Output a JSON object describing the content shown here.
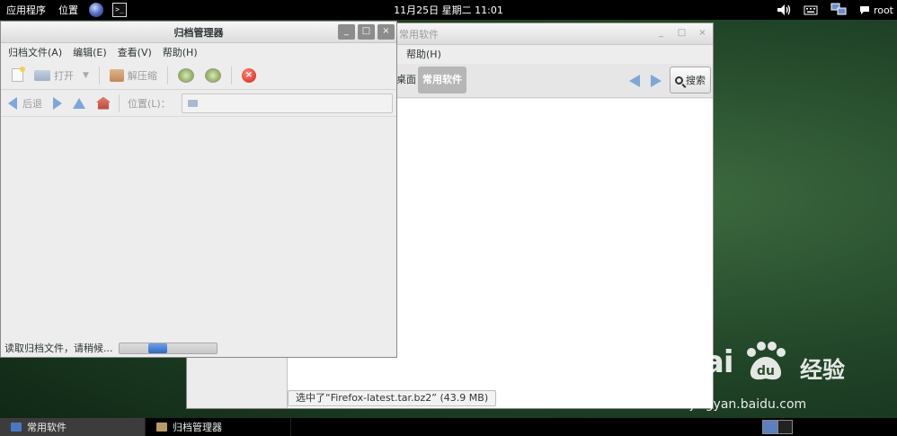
{
  "top_panel": {
    "applications": "应用程序",
    "places": "位置",
    "clock": "11月25日 星期二 11:01",
    "user": "root",
    "terminal_glyph": ">_"
  },
  "archive_manager": {
    "title": "归档管理器",
    "controls": {
      "minimize": "_",
      "maximize": "□",
      "close": "×"
    },
    "menu": [
      "归档文件(A)",
      "编辑(E)",
      "查看(V)",
      "帮助(H)"
    ],
    "toolbar": {
      "open": "打开",
      "extract": "解压缩",
      "stop_glyph": "×"
    },
    "locbar": {
      "back": "后退",
      "location_label": "位置(L)："
    },
    "status": "读取归档文件，请稍候...",
    "progress_start_fraction": 0.3,
    "progress_width_fraction": 0.2
  },
  "file_manager": {
    "title": "常用软件",
    "controls": {
      "minimize": "_",
      "maximize": "□",
      "close": "×"
    },
    "menu_help": "帮助(H)",
    "crumb_desktop_partial": "桌面",
    "crumb_current": "常用软件",
    "search": "搜索",
    "status": "选中了“Firefox-latest.tar.bz2” (43.9 MB)"
  },
  "taskbar": {
    "tasks": [
      "常用软件",
      "归档管理器"
    ]
  },
  "watermark": {
    "logo": "Bai",
    "paw_text": "du",
    "cn": "经验",
    "url": "jingyan.baidu.com"
  }
}
